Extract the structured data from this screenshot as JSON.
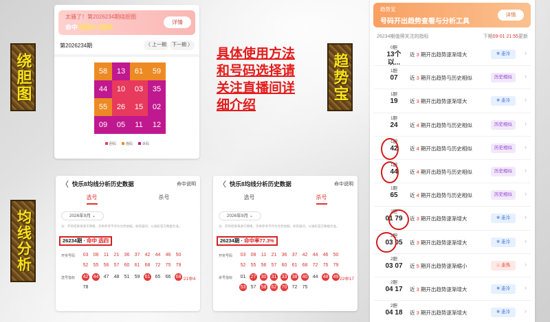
{
  "labels": {
    "rao_dan": "绕胆图",
    "qu_shi": "趋势宝",
    "jun_xian": "均线分析"
  },
  "headline": [
    "具体使用方法",
    "和号码选择请",
    "关注直播间详",
    "细介绍"
  ],
  "panel1": {
    "banner_line1": "太骚了！第2026234期绕胆图",
    "banner_line2_prefix": "命中",
    "banner_line2_hit": "4胆码+1拖码",
    "detail_btn": "详情",
    "period": "第2026234期",
    "prev": "〈 上一期",
    "next": "下一期 〉",
    "grid": [
      {
        "n": "58",
        "c": "o"
      },
      {
        "n": "13",
        "c": "m"
      },
      {
        "n": "61",
        "c": "o"
      },
      {
        "n": "59",
        "c": "o"
      },
      {
        "n": "44",
        "c": "m"
      },
      {
        "n": "10",
        "c": "r"
      },
      {
        "n": "03",
        "c": "r"
      },
      {
        "n": "35",
        "c": "m"
      },
      {
        "n": "55",
        "c": "o"
      },
      {
        "n": "26",
        "c": "r"
      },
      {
        "n": "15",
        "c": "r"
      },
      {
        "n": "02",
        "c": "m"
      },
      {
        "n": "09",
        "c": "m"
      },
      {
        "n": "05",
        "c": "m"
      },
      {
        "n": "11",
        "c": "m"
      },
      {
        "n": "12",
        "c": "m"
      }
    ],
    "legend": [
      "胆码",
      "拖码",
      "杀码"
    ],
    "colors": {
      "orange": "#ed8a24",
      "magenta": "#c0188f",
      "red": "#e83a5c"
    }
  },
  "panel2": {
    "back": "〈",
    "title": "快乐8均线分析历史数据",
    "help": "命中说明",
    "tabs": [
      "选号",
      "杀号"
    ],
    "date": "2026年9月 ⌄",
    "note": "注：开奖结果来源于网络，仅供参考不作为兑奖依据，如有疑问，以福彩官方数据为准。",
    "result_prefix": "26234期 · ",
    "result_hit": "命中 选四",
    "row_label_1": "开奖号码",
    "row_label_2": "选号指标",
    "draw": [
      "03",
      "08",
      "11",
      "21",
      "36",
      "37",
      "42",
      "44",
      "46",
      "50",
      "52",
      "55",
      "56",
      "57",
      "60",
      "61",
      "68",
      "72",
      "75",
      "79"
    ],
    "picks": [
      {
        "n": "42",
        "b": true
      },
      {
        "n": "44",
        "b": true
      },
      {
        "n": "47",
        "b": false
      },
      {
        "n": "48",
        "b": false
      },
      {
        "n": "51",
        "b": false
      },
      {
        "n": "59",
        "b": false
      },
      {
        "n": "61",
        "b": true
      },
      {
        "n": "65",
        "b": false
      },
      {
        "n": "66",
        "b": false
      },
      {
        "n": "68",
        "b": true
      },
      {
        "n": "78",
        "b": false
      }
    ],
    "aside": "21中4"
  },
  "panel3": {
    "back": "〈",
    "title": "快乐8均线分析历史数据",
    "help": "命中说明",
    "tabs": [
      "选号",
      "杀号"
    ],
    "date": "2026年9月 ⌄",
    "note": "注：开奖结果来源于网络，仅供参考不作为兑奖依据，如有疑问，以福彩官方数据为准。",
    "result_prefix": "26234期 · ",
    "result_hit": "命中率77.3%",
    "row_label_1": "开奖号码",
    "row_label_2": "杀号指标",
    "draw": [
      "03",
      "08",
      "11",
      "21",
      "36",
      "37",
      "42",
      "44",
      "46",
      "50",
      "52",
      "55",
      "56",
      "57",
      "60",
      "61",
      "68",
      "72",
      "75",
      "79"
    ],
    "picks": [
      {
        "n": "01",
        "b": false
      },
      {
        "n": "27",
        "b": true
      },
      {
        "n": "30",
        "b": true
      },
      {
        "n": "31",
        "b": true
      },
      {
        "n": "33",
        "b": true
      },
      {
        "n": "38",
        "b": true
      },
      {
        "n": "40",
        "b": true
      },
      {
        "n": "44",
        "b": false
      },
      {
        "n": "48",
        "b": true
      },
      {
        "n": "49",
        "b": true
      },
      {
        "n": "53",
        "b": true
      },
      {
        "n": "57",
        "b": false
      },
      {
        "n": "58",
        "b": true
      },
      {
        "n": "62",
        "b": true
      },
      {
        "n": "70",
        "b": true
      },
      {
        "n": "72",
        "b": false
      },
      {
        "n": "75",
        "b": false
      }
    ],
    "aside": "22中17"
  },
  "panel4": {
    "banner_line1": "趋势宝",
    "banner_line2": "号码开出趋势查看与分析工具",
    "detail_btn": "详情",
    "sub": "26234期值得关注的指标",
    "time_prefix": "下期",
    "time_red": "09-01 21:55",
    "time_suffix": "更新",
    "rows": [
      {
        "a": "0胆",
        "b": "13个以...",
        "desc_pre": "近 ",
        "desc_num": "3",
        "desc_post": " 期开出趋势逐渐增大",
        "tag": "❄ 走冷",
        "tag_type": "cold"
      },
      {
        "a": "1胆",
        "b": "07",
        "desc_pre": "近 ",
        "desc_num": "3",
        "desc_post": " 期开出趋势与历史相似",
        "tag": "历史相似",
        "tag_type": "hist"
      },
      {
        "a": "1胆",
        "b": "19",
        "desc_pre": "近 ",
        "desc_num": "3",
        "desc_post": " 期开出趋势逐渐增大",
        "tag": "❄ 走冷",
        "tag_type": "cold"
      },
      {
        "a": "1胆",
        "b": "24",
        "desc_pre": "近 ",
        "desc_num": "4",
        "desc_post": " 期开出趋势与历史相似",
        "tag": "历史相似",
        "tag_type": "hist"
      },
      {
        "a": "1胆",
        "b": "42",
        "desc_pre": "近 ",
        "desc_num": "4",
        "desc_post": " 期开出趋势与历史相似",
        "tag": "历史相似",
        "tag_type": "hist"
      },
      {
        "a": "1胆",
        "b": "44",
        "desc_pre": "近 ",
        "desc_num": "4",
        "desc_post": " 期开出趋势与历史相似",
        "tag": "历史相似",
        "tag_type": "hist"
      },
      {
        "a": "1胆",
        "b": "65",
        "desc_pre": "近 ",
        "desc_num": "4",
        "desc_post": " 期开出趋势与历史相似",
        "tag": "历史相似",
        "tag_type": "hist"
      },
      {
        "a": "2胆",
        "b": "01 79",
        "desc_pre": "近 ",
        "desc_num": "3",
        "desc_post": " 期开出趋势逐渐增大",
        "tag": "❄ 走冷",
        "tag_type": "cold"
      },
      {
        "a": "2胆",
        "b": "03 05",
        "desc_pre": "近 ",
        "desc_num": "3",
        "desc_post": " 期开出趋势逐渐增大",
        "tag": "❄ 走冷",
        "tag_type": "cold"
      },
      {
        "a": "2胆",
        "b": "03 07",
        "desc_pre": "近 ",
        "desc_num": "5",
        "desc_post": " 期开出趋势逐渐缩小",
        "tag": "♨ 走热",
        "tag_type": "hot"
      },
      {
        "a": "2胆",
        "b": "04 17",
        "desc_pre": "近 ",
        "desc_num": "3",
        "desc_post": " 期开出趋势逐渐增大",
        "tag": "❄ 走冷",
        "tag_type": "cold"
      },
      {
        "a": "2胆",
        "b": "04 18",
        "desc_pre": "近 ",
        "desc_num": "3",
        "desc_post": " 期开出趋势逐渐增大",
        "tag": "❄ 走冷",
        "tag_type": "cold"
      }
    ],
    "arrow": "›"
  }
}
